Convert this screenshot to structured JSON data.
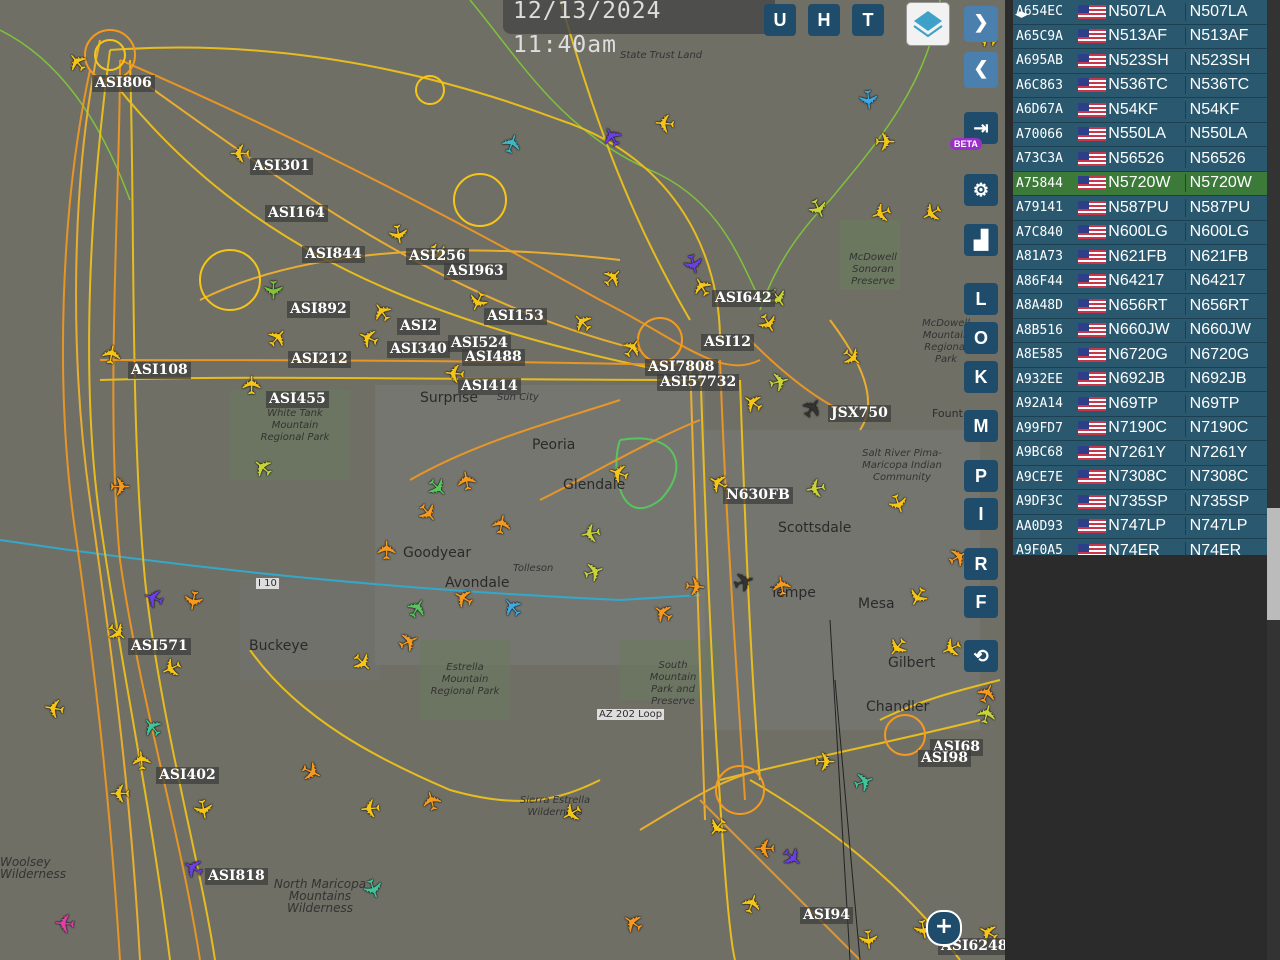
{
  "timestamp": "12/13/2024 11:40am",
  "top_buttons": [
    "U",
    "H",
    "T"
  ],
  "side_buttons": [
    "L",
    "O",
    "K",
    "M",
    "P",
    "I",
    "R",
    "F"
  ],
  "beta_badge": "BETA",
  "aircraft_labels": [
    "ASI806",
    "ASI301",
    "ASI164",
    "ASI844",
    "ASI256",
    "ASI963",
    "ASI892",
    "ASI153",
    "ASI2",
    "ASI524",
    "ASI340",
    "ASI488",
    "ASI212",
    "ASI108",
    "ASI414",
    "ASI455",
    "ASI642",
    "ASI12",
    "ASI7808",
    "ASI57732",
    "JSX750",
    "N630FB",
    "ASI571",
    "ASI402",
    "ASI818",
    "ASI68",
    "ASI98",
    "ASI94",
    "ASI6248"
  ],
  "map_labels": {
    "surprise": "Surprise",
    "sun_city": "Sun City",
    "peoria": "Peoria",
    "glendale": "Glendale",
    "goodyear": "Goodyear",
    "avondale": "Avondale",
    "tolleson": "Tolleson",
    "buckeye": "Buckeye",
    "tempe": "Tempe",
    "mesa": "Mesa",
    "gilbert": "Gilbert",
    "chandler": "Chandler",
    "scottsdale": "Scottsdale",
    "fountain": "Fount",
    "i10": "I 10",
    "az202": "AZ 202 Loop",
    "state_trust": "State Trust Land",
    "mcdowell_preserve": "McDowell Sonoran Preserve",
    "mcdowell_mountain": "McDowell Mountain Regional Park",
    "white_tank": "White Tank Mountain Regional Park",
    "salt_river": "Salt River Pima-Maricopa Indian Community",
    "estrella": "Estrella Mountain Regional Park",
    "south_mountain": "South Mountain Park and Preserve",
    "sierra_estrella": "Sierra Estrella Wilderness",
    "north_maricopa": "North Maricopa Mountains Wilderness",
    "woolsey": "Woolsey Wilderness"
  },
  "aircraft_list": [
    {
      "hex": "A654EC",
      "callsign": "N507LA",
      "reg": "N507LA"
    },
    {
      "hex": "A65C9A",
      "callsign": "N513AF",
      "reg": "N513AF"
    },
    {
      "hex": "A695AB",
      "callsign": "N523SH",
      "reg": "N523SH"
    },
    {
      "hex": "A6C863",
      "callsign": "N536TC",
      "reg": "N536TC"
    },
    {
      "hex": "A6D67A",
      "callsign": "N54KF",
      "reg": "N54KF"
    },
    {
      "hex": "A70066",
      "callsign": "N550LA",
      "reg": "N550LA"
    },
    {
      "hex": "A73C3A",
      "callsign": "N56526",
      "reg": "N56526"
    },
    {
      "hex": "A75844",
      "callsign": "N5720W",
      "reg": "N5720W",
      "selected": true
    },
    {
      "hex": "A79141",
      "callsign": "N587PU",
      "reg": "N587PU"
    },
    {
      "hex": "A7C840",
      "callsign": "N600LG",
      "reg": "N600LG"
    },
    {
      "hex": "A81A73",
      "callsign": "N621FB",
      "reg": "N621FB"
    },
    {
      "hex": "A86F44",
      "callsign": "N64217",
      "reg": "N64217"
    },
    {
      "hex": "A8A48D",
      "callsign": "N656RT",
      "reg": "N656RT"
    },
    {
      "hex": "A8B516",
      "callsign": "N660JW",
      "reg": "N660JW"
    },
    {
      "hex": "A8E585",
      "callsign": "N6720G",
      "reg": "N6720G"
    },
    {
      "hex": "A932EE",
      "callsign": "N692JB",
      "reg": "N692JB"
    },
    {
      "hex": "A92A14",
      "callsign": "N69TP",
      "reg": "N69TP"
    },
    {
      "hex": "A99FD7",
      "callsign": "N7190C",
      "reg": "N7190C"
    },
    {
      "hex": "A9BC68",
      "callsign": "N7261Y",
      "reg": "N7261Y"
    },
    {
      "hex": "A9CE7E",
      "callsign": "N7308C",
      "reg": "N7308C"
    },
    {
      "hex": "A9DF3C",
      "callsign": "N735SP",
      "reg": "N735SP"
    },
    {
      "hex": "AA0D93",
      "callsign": "N747LP",
      "reg": "N747LP"
    },
    {
      "hex": "A9F0A5",
      "callsign": "N74ER",
      "reg": "N74ER"
    }
  ],
  "colors": {
    "track_yellow": "#f5c518",
    "track_orange": "#f59a1e",
    "panel_row": "#29586f",
    "panel_selected": "#3c7a3a",
    "map_bg": "#6f6f66"
  },
  "icons": [
    "plane-icon",
    "layers-icon",
    "chevron-right-icon",
    "chevron-left-icon",
    "login-icon",
    "gear-icon",
    "ranking-icon",
    "replay-icon",
    "expand-arrows-icon",
    "plus-icon"
  ]
}
